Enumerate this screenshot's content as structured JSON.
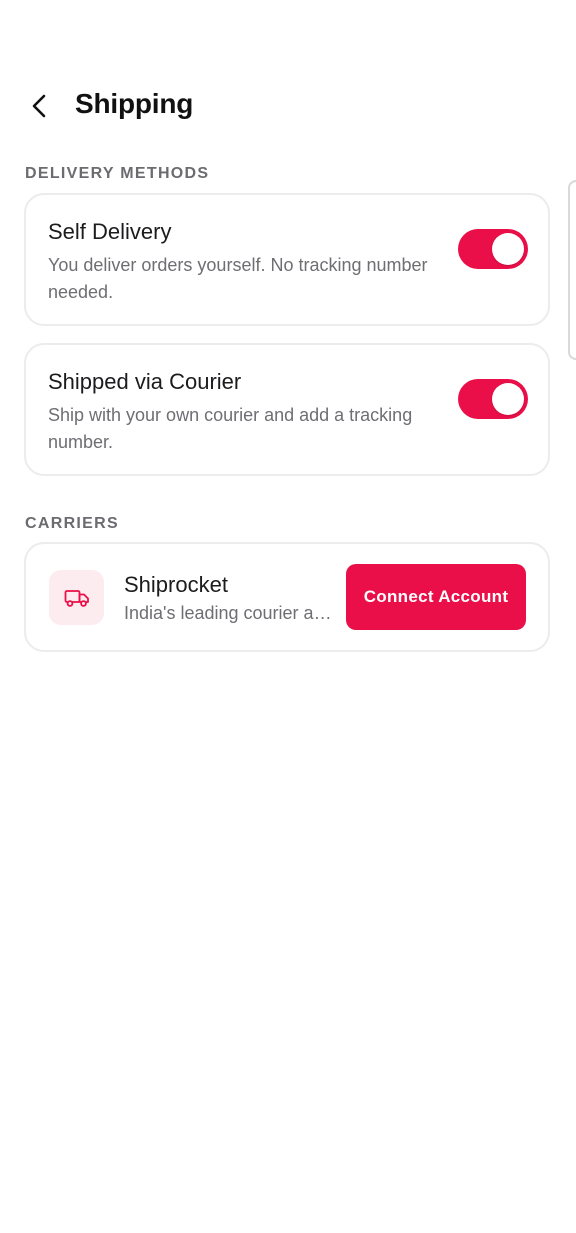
{
  "header": {
    "title": "Shipping",
    "back_icon": "chevron-left-icon"
  },
  "sections": {
    "delivery_methods_label": "DELIVERY METHODS",
    "carriers_label": "CARRIERS"
  },
  "delivery_methods": [
    {
      "title": "Self Delivery",
      "description": "You deliver orders yourself. No tracking number needed.",
      "enabled": true
    },
    {
      "title": "Shipped via Courier",
      "description": "Ship with your own courier and add a tracking number.",
      "enabled": true
    }
  ],
  "carriers": [
    {
      "name": "Shiprocket",
      "description": "India's leading courier aggregator",
      "icon": "truck-icon",
      "action_label": "Connect Account"
    }
  ],
  "colors": {
    "accent": "#ea0f48",
    "icon_background": "#fdecef",
    "muted_text": "#6e6e73",
    "border": "#ececee"
  }
}
